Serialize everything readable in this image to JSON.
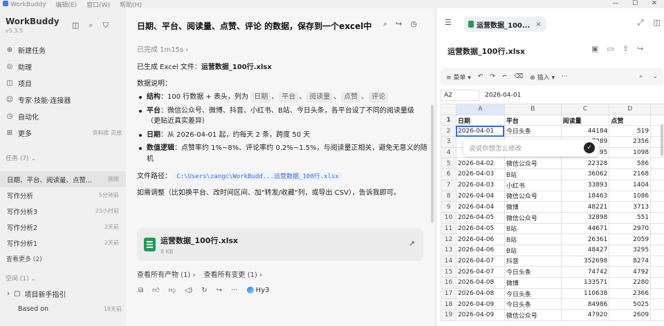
{
  "titlebar": {
    "app": "WorkBuddy",
    "menus": [
      "编辑(E)",
      "窗口(W)",
      "帮助(H)"
    ]
  },
  "sidebar": {
    "brand": "WorkBuddy",
    "version": "v5.3.5",
    "nav": [
      {
        "label": "新建任务",
        "icon": "plus-circle-icon",
        "glyph": "⊕"
      },
      {
        "label": "助理",
        "icon": "assistant-icon",
        "glyph": "◎"
      },
      {
        "label": "项目",
        "icon": "project-icon",
        "glyph": "◫"
      },
      {
        "label": "专家·技能·连接器",
        "icon": "expert-icon",
        "glyph": "☺"
      },
      {
        "label": "自动化",
        "icon": "clock-icon",
        "glyph": "◷"
      },
      {
        "label": "更多",
        "icon": "more-icon",
        "glyph": "⊞",
        "extra": "资料库 灵感"
      }
    ],
    "tasks_header": "任务 (7)",
    "tasks": [
      {
        "title": "日期、平台、阅读量、点赞...",
        "time": "刚刚",
        "active": true
      },
      {
        "title": "写作分析",
        "time": "5分钟前"
      },
      {
        "title": "写作分析3",
        "time": "23小时前"
      },
      {
        "title": "写作分析2",
        "time": "2天前"
      },
      {
        "title": "写作分析1",
        "time": "2天前"
      }
    ],
    "more": "查看更多 (2)",
    "space_header": "空间 (1)",
    "guide": "项目新手指引",
    "based_on": "Based on",
    "based_on_time": "18天前"
  },
  "chat": {
    "title": "日期、平台、阅读量、点赞、评论 的数据，保存到一个excel中",
    "done": "已完成 1m15s",
    "generated_prefix": "已生成 Excel 文件：",
    "generated_file": "运营数据_100行.xlsx",
    "desc_header": "数据说明：",
    "bullets": [
      {
        "key": "结构",
        "text": "：100 行数据 + 表头，列为",
        "chips": [
          "日期",
          "平台",
          "阅读量",
          "点赞",
          "评论"
        ]
      },
      {
        "key": "平台",
        "text": "：微信公众号、微博、抖音、小红书、B站、今日头条，各平台设了不同的阅读量级（更贴近真实差异）"
      },
      {
        "key": "日期",
        "text": "：从 2026-04-01 起，约每天 2 条，跨度 50 天"
      },
      {
        "key": "数值逻辑",
        "text": "：点赞率约 1%~8%、评论率约 0.2%~1.5%，与阅读量正相关，避免无意义的随机"
      }
    ],
    "path_label": "文件路径：",
    "path": "C:\\Users\\zangc\\WorkBudd...运营数据_100行.xlsx",
    "adjust": "如需调整（比如换平台、改时间区间、加\"转发/收藏\"列，或导出 CSV），告诉我即可。",
    "file_name": "运营数据_100行.xlsx",
    "file_size": "8 KB",
    "link1": "查看所有产物 (1)",
    "link2": "查看所有变更 (1)",
    "model": "Hy3"
  },
  "panel": {
    "tab": "运营数据_100...",
    "doc": "运营数据_100行.xlsx",
    "menu": "菜单",
    "insert": "插入",
    "cell_ref": "A2",
    "cell_value": "2026-04-01",
    "cols": [
      "A",
      "B",
      "C",
      "D"
    ],
    "header": [
      "日期",
      "平台",
      "阅读量",
      "点赞"
    ],
    "rows": [
      [
        "2026-04-01",
        "今日头条",
        "44184",
        "519"
      ],
      [
        "",
        "",
        "",
        "2356"
      ],
      [
        "",
        "",
        "",
        "1098"
      ],
      [
        "2026-04-02",
        "微信公众号",
        "22328",
        "586"
      ],
      [
        "2026-04-03",
        "B站",
        "36062",
        "2168"
      ],
      [
        "2026-04-03",
        "小红书",
        "33893",
        "1404"
      ],
      [
        "2026-04-04",
        "微信公众号",
        "18463",
        "1086"
      ],
      [
        "2026-04-04",
        "微博",
        "48221",
        "3713"
      ],
      [
        "2026-04-05",
        "微信公众号",
        "32898",
        "551"
      ],
      [
        "2026-04-05",
        "B站",
        "44671",
        "2970"
      ],
      [
        "2026-04-06",
        "B站",
        "26361",
        "2059"
      ],
      [
        "2026-04-06",
        "B站",
        "48427",
        "3295"
      ],
      [
        "2026-04-07",
        "抖音",
        "352698",
        "8274"
      ],
      [
        "2026-04-07",
        "今日头条",
        "74742",
        "4792"
      ],
      [
        "2026-04-08",
        "微博",
        "133571",
        "2280"
      ],
      [
        "2026-04-08",
        "今日头条",
        "110638",
        "2366"
      ],
      [
        "2026-04-09",
        "今日头条",
        "84986",
        "5025"
      ],
      [
        "2026-04-09",
        "微信公众号",
        "47920",
        "2609"
      ]
    ],
    "partial": {
      "r3c": "7289",
      "r4c": "8,395"
    },
    "popup_placeholder": "说说你想怎么修改"
  }
}
